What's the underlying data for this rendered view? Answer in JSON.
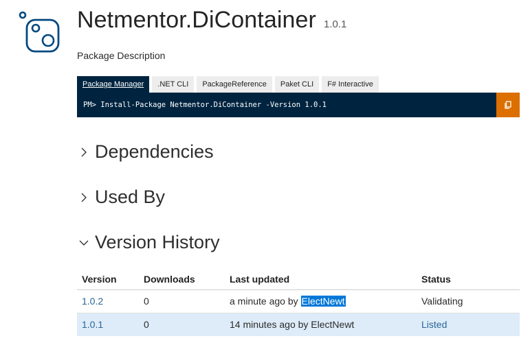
{
  "package": {
    "name": "Netmentor.DiContainer",
    "version": "1.0.1",
    "description": "Package Description"
  },
  "install": {
    "tabs": [
      {
        "label": "Package Manager",
        "active": true
      },
      {
        "label": ".NET CLI",
        "active": false
      },
      {
        "label": "PackageReference",
        "active": false
      },
      {
        "label": "Paket CLI",
        "active": false
      },
      {
        "label": "F# Interactive",
        "active": false
      }
    ],
    "command": "PM> Install-Package Netmentor.DiContainer -Version 1.0.1"
  },
  "sections": {
    "dependencies": "Dependencies",
    "used_by": "Used By",
    "version_history": "Version History"
  },
  "history": {
    "headers": {
      "version": "Version",
      "downloads": "Downloads",
      "last_updated": "Last updated",
      "status": "Status"
    },
    "rows": [
      {
        "version": "1.0.2",
        "downloads": "0",
        "updated_prefix": "a minute ago by ",
        "author": "ElectNewt",
        "status": "Validating"
      },
      {
        "version": "1.0.1",
        "downloads": "0",
        "updated_prefix": "14 minutes ago by ",
        "author": "ElectNewt",
        "status": "Listed"
      }
    ]
  },
  "colors": {
    "command_bg": "#002440",
    "copy_button": "#dd6e00",
    "link": "#2a6496",
    "selected_row": "#deecf9",
    "text_highlight": "#0078d7"
  }
}
